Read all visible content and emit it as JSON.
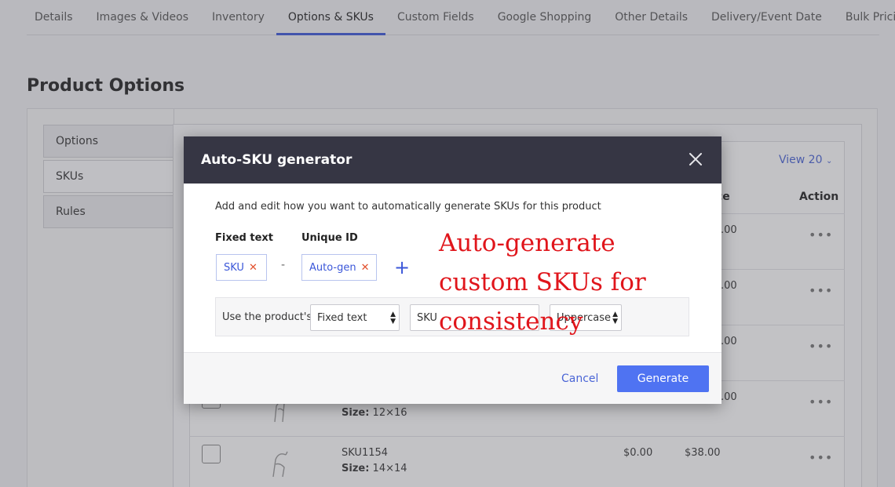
{
  "tabs": [
    {
      "label": "Details"
    },
    {
      "label": "Images & Videos"
    },
    {
      "label": "Inventory"
    },
    {
      "label": "Options & SKUs",
      "active": true
    },
    {
      "label": "Custom Fields"
    },
    {
      "label": "Google Shopping"
    },
    {
      "label": "Other Details"
    },
    {
      "label": "Delivery/Event Date"
    },
    {
      "label": "Bulk Pricing"
    }
  ],
  "page_title": "Product Options",
  "sidebar": {
    "items": [
      {
        "label": "Options"
      },
      {
        "label": "SKUs",
        "active": true
      },
      {
        "label": "Rules"
      }
    ]
  },
  "table": {
    "view_label": "View 20",
    "headers": {
      "price_partial": "ce",
      "action": "Action"
    },
    "rows": [
      {
        "price": ".00"
      },
      {
        "price": ".00"
      },
      {
        "price": ".00"
      },
      {
        "price": ".00",
        "size_label": "Size:",
        "size_value": "12×16"
      },
      {
        "sku": "SKU1154",
        "size_label": "Size:",
        "size_value": "14×14",
        "cost": "$0.00",
        "price": "$38.00"
      }
    ]
  },
  "modal": {
    "title": "Auto-SKU generator",
    "description": "Add and edit how you want to automatically generate SKUs for this product",
    "fixed_text_label": "Fixed text",
    "unique_id_label": "Unique ID",
    "chips": {
      "fixed": "SKU",
      "unique": "Auto-gen"
    },
    "separator": "-",
    "config": {
      "prefix_label": "Use the product's",
      "source_select": "Fixed text",
      "text_value": "SKU",
      "case_select": "Uppercase"
    },
    "cancel_label": "Cancel",
    "generate_label": "Generate"
  },
  "promo_text": "Auto-generate custom SKUs for consistency",
  "colors": {
    "accent": "#3b57d9",
    "primary_button": "#4f73f2",
    "modal_header": "#363644",
    "promo": "#e0151b",
    "remove_x": "#e2502c"
  }
}
